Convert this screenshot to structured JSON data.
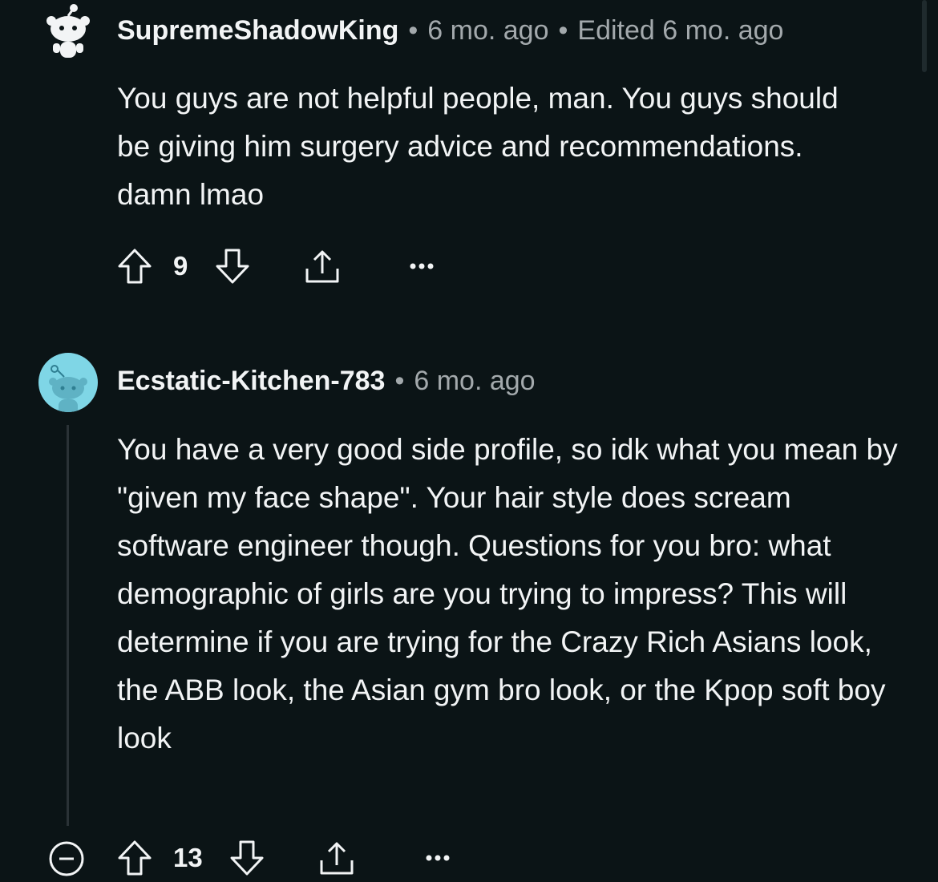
{
  "comments": [
    {
      "author": "SupremeShadowKing",
      "time": "6 mo. ago",
      "edited": "Edited 6 mo. ago",
      "body": [
        "You guys are not helpful people, man. You guys should be giving him surgery advice and recommendations. damn lmao"
      ],
      "score": "9",
      "avatar_icon": "snoo-avatar-icon",
      "avatar_color": "#0b1416"
    },
    {
      "author": "Ecstatic-Kitchen-783",
      "time": "6 mo. ago",
      "body": [
        "You have a very good side profile, so idk what you mean by \"given my face shape\". Your hair style does scream software engineer though. Questions for you bro: what demographic of girls are you trying to impress? This will determine if you are trying for the Crazy Rich Asians look, the ABB look, the Asian gym bro look, or the Kpop soft boy look"
      ],
      "score": "13",
      "avatar_icon": "snoo-avatar-icon",
      "avatar_color": "#7fd6e6"
    }
  ],
  "theme": {
    "background": "#0b1416",
    "text": "#f2f4f5",
    "meta": "#a3a9ac"
  },
  "icons": {
    "upvote": "arrow-up-icon",
    "downvote": "arrow-down-icon",
    "share": "share-icon",
    "more": "more-options-icon",
    "collapse": "collapse-icon"
  }
}
